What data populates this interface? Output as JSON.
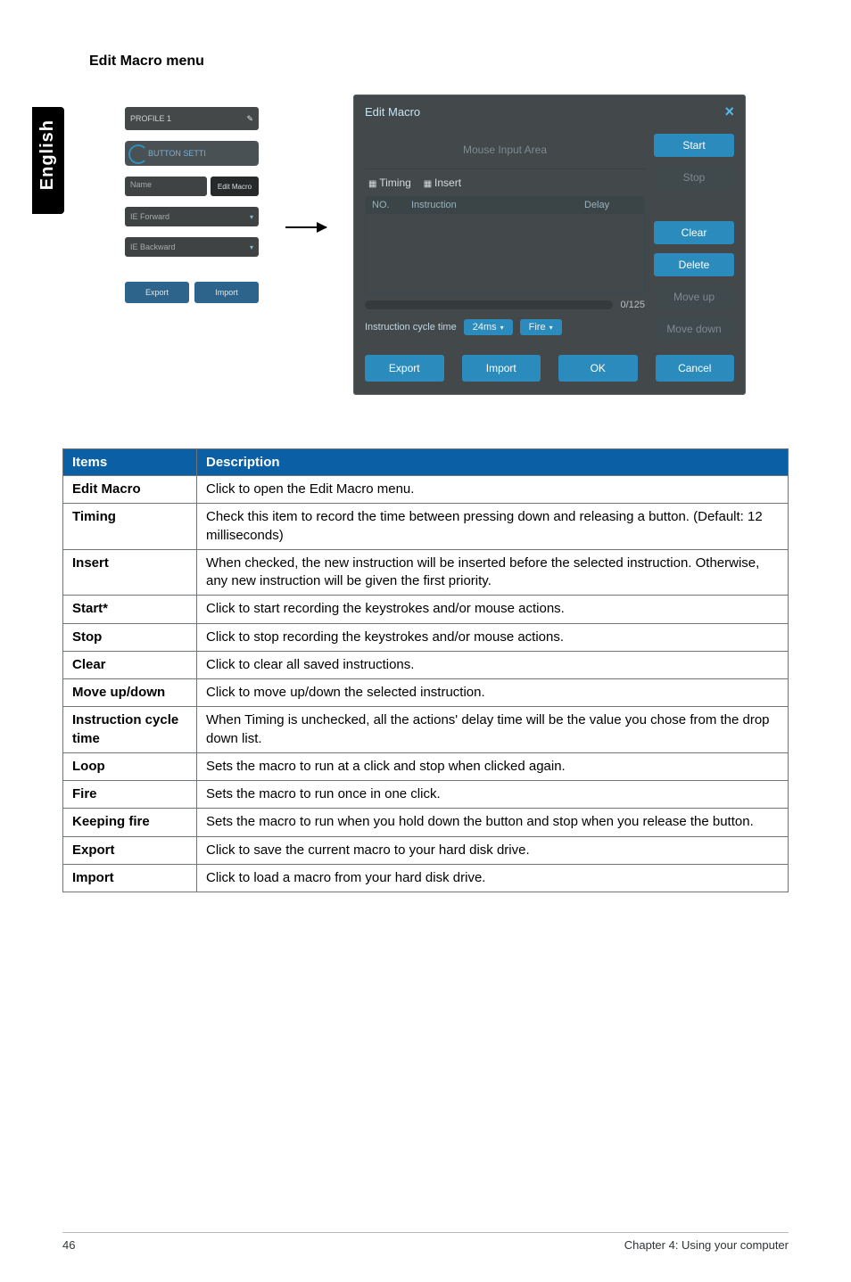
{
  "side_tab": "English",
  "heading": "Edit Macro menu",
  "side_panel": {
    "profile_label": "PROFILE 1",
    "button_setting": "BUTTON SETTI",
    "name_label": "Name",
    "edit_macro_btn": "Edit Macro",
    "forward_label": "IE Forward",
    "backward_label": "IE Backward",
    "export_btn": "Export",
    "import_btn": "Import"
  },
  "dialog": {
    "title": "Edit Macro",
    "mouse_area": "Mouse Input Area",
    "tab_timing": "Timing",
    "tab_insert": "Insert",
    "col_no": "NO.",
    "col_instruction": "Instruction",
    "col_delay": "Delay",
    "scroll_count": "0/125",
    "cycle_label": "Instruction cycle time",
    "cycle_value": "24ms",
    "fire_label": "Fire",
    "btn_start": "Start",
    "btn_stop": "Stop",
    "btn_clear": "Clear",
    "btn_delete": "Delete",
    "btn_moveup": "Move up",
    "btn_movedown": "Move down",
    "btn_export": "Export",
    "btn_import": "Import",
    "btn_ok": "OK",
    "btn_cancel": "Cancel"
  },
  "table": {
    "header_items": "Items",
    "header_desc": "Description",
    "rows": [
      {
        "item": "Edit Macro",
        "desc": "Click to open the Edit Macro menu."
      },
      {
        "item": "Timing",
        "desc": "Check this item to record the time between pressing down and releasing a button. (Default: 12 milliseconds)"
      },
      {
        "item": "Insert",
        "desc": "When checked, the new instruction will be inserted before the selected instruction. Otherwise, any new instruction will be given the first priority."
      },
      {
        "item": "Start*",
        "desc": "Click to start recording the keystrokes and/or mouse actions."
      },
      {
        "item": "Stop",
        "desc": "Click to stop recording the keystrokes and/or mouse actions."
      },
      {
        "item": "Clear",
        "desc": "Click to clear all saved instructions."
      },
      {
        "item": "Move up/down",
        "desc": "Click to move up/down the selected instruction."
      },
      {
        "item": "Instruction cycle time",
        "desc": "When Timing is unchecked, all the actions' delay time will be the value you chose from the drop down list."
      },
      {
        "item": "Loop",
        "desc": "Sets the macro to run at a click and stop when clicked again."
      },
      {
        "item": "Fire",
        "desc": "Sets the macro to run once in one click."
      },
      {
        "item": "Keeping fire",
        "desc": "Sets the macro to run when you hold down the button and stop when you release the button."
      },
      {
        "item": "Export",
        "desc": "Click to save the current macro to your hard disk drive."
      },
      {
        "item": "Import",
        "desc": "Click to load a macro from your hard disk drive."
      }
    ]
  },
  "footer": {
    "page_no": "46",
    "chapter": "Chapter 4: Using your computer"
  }
}
